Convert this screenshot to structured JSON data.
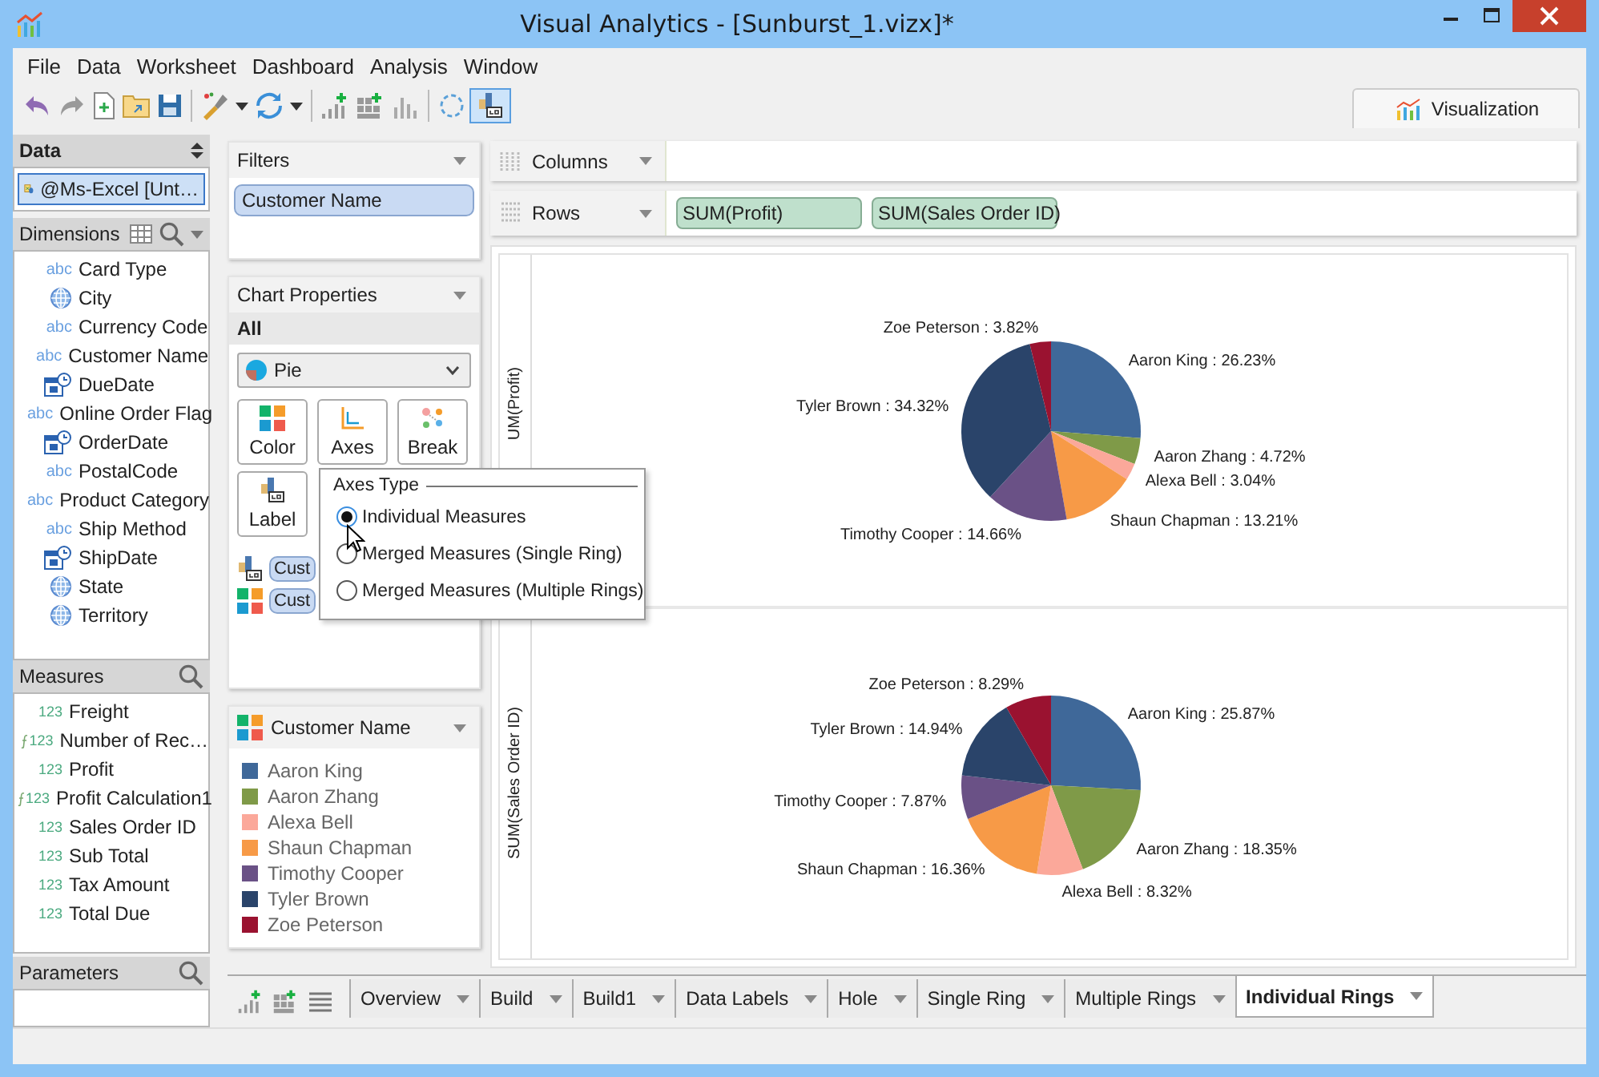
{
  "window": {
    "title": "Visual Analytics - [Sunburst_1.vizx]*"
  },
  "menu": [
    "File",
    "Data",
    "Worksheet",
    "Dashboard",
    "Analysis",
    "Window"
  ],
  "toolbar": {
    "label_toggle": {
      "selected": true
    }
  },
  "visualization_tab": {
    "label": "Visualization"
  },
  "data_panel": {
    "title": "Data",
    "source": {
      "label": "@Ms-Excel [Unt…",
      "selected": true
    },
    "dimensions": {
      "title": "Dimensions",
      "items": [
        {
          "name": "Card Type",
          "kind": "text",
          "type_badge": "abc"
        },
        {
          "name": "City",
          "kind": "geo"
        },
        {
          "name": "Currency Code",
          "kind": "text",
          "type_badge": "abc"
        },
        {
          "name": "Customer Name",
          "kind": "text",
          "type_badge": "abc"
        },
        {
          "name": "DueDate",
          "kind": "date"
        },
        {
          "name": "Online Order Flag",
          "kind": "text",
          "type_badge": "abc"
        },
        {
          "name": "OrderDate",
          "kind": "date"
        },
        {
          "name": "PostalCode",
          "kind": "text",
          "type_badge": "abc"
        },
        {
          "name": "Product Category",
          "kind": "text",
          "type_badge": "abc"
        },
        {
          "name": "Ship Method",
          "kind": "text",
          "type_badge": "abc"
        },
        {
          "name": "ShipDate",
          "kind": "date"
        },
        {
          "name": "State",
          "kind": "geo"
        },
        {
          "name": "Territory",
          "kind": "geo"
        }
      ]
    },
    "measures": {
      "title": "Measures",
      "items": [
        {
          "name": "Freight",
          "type_badge": "123",
          "calculated": false
        },
        {
          "name": "Number of Rec…",
          "type_badge": "123",
          "calculated": true
        },
        {
          "name": "Profit",
          "type_badge": "123",
          "calculated": false
        },
        {
          "name": "Profit Calculation1",
          "type_badge": "123",
          "calculated": true
        },
        {
          "name": "Sales Order ID",
          "type_badge": "123",
          "calculated": false
        },
        {
          "name": "Sub Total",
          "type_badge": "123",
          "calculated": false
        },
        {
          "name": "Tax Amount",
          "type_badge": "123",
          "calculated": false
        },
        {
          "name": "Total Due",
          "type_badge": "123",
          "calculated": false
        }
      ]
    },
    "parameters": {
      "title": "Parameters"
    }
  },
  "filters": {
    "title": "Filters",
    "pills": [
      "Customer Name"
    ]
  },
  "chart_properties": {
    "title": "Chart Properties",
    "scope": "All",
    "chart_type": "Pie",
    "buttons": [
      {
        "label": "Color",
        "kind": "color"
      },
      {
        "label": "Axes",
        "kind": "axes"
      },
      {
        "label": "Break",
        "kind": "break"
      },
      {
        "label": "Label",
        "kind": "label"
      }
    ],
    "marks": [
      {
        "kind": "label",
        "pill": "Cust"
      },
      {
        "kind": "color",
        "pill": "Cust"
      }
    ]
  },
  "axes_popup": {
    "title": "Axes Type",
    "options": [
      {
        "label": "Individual Measures",
        "selected": true
      },
      {
        "label": "Merged Measures (Single Ring)",
        "selected": false
      },
      {
        "label": "Merged Measures (Multiple Rings)",
        "selected": false
      }
    ]
  },
  "legend": {
    "title": "Customer Name",
    "items": [
      {
        "name": "Aaron King",
        "color": "#3f6899"
      },
      {
        "name": "Aaron Zhang",
        "color": "#7f9a48"
      },
      {
        "name": "Alexa Bell",
        "color": "#fba89a"
      },
      {
        "name": "Shaun Chapman",
        "color": "#f79a47"
      },
      {
        "name": "Timothy Cooper",
        "color": "#6a5186"
      },
      {
        "name": "Tyler Brown",
        "color": "#2a446a"
      },
      {
        "name": "Zoe Peterson",
        "color": "#9a1230"
      }
    ]
  },
  "shelves": {
    "columns": {
      "label": "Columns"
    },
    "rows": {
      "label": "Rows",
      "pills": [
        "SUM(Profit)",
        "SUM(Sales Order ID)"
      ]
    }
  },
  "charts": [
    {
      "axis_label": "UM(Profit)",
      "chart_data": {
        "type": "pie",
        "values": [
          26.23,
          4.72,
          3.04,
          13.21,
          14.66,
          34.32,
          3.82
        ],
        "value_labels": [
          "Aaron King : 26.23%",
          "Aaron Zhang : 4.72%",
          "Alexa Bell : 3.04%",
          "Shaun Chapman : 13.21%",
          "Timothy Cooper : 14.66%",
          "Tyler Brown : 34.32%",
          "Zoe Peterson : 3.82%"
        ]
      }
    },
    {
      "axis_label": "SUM(Sales Order ID)",
      "chart_data": {
        "type": "pie",
        "values": [
          25.87,
          18.35,
          8.32,
          16.36,
          7.87,
          14.94,
          8.29
        ],
        "value_labels": [
          "Aaron King : 25.87%",
          "Aaron Zhang : 18.35%",
          "Alexa Bell : 8.32%",
          "Shaun Chapman : 16.36%",
          "Timothy Cooper : 7.87%",
          "Tyler Brown : 14.94%",
          "Zoe Peterson : 8.29%"
        ]
      }
    }
  ],
  "sheet_tabs": [
    {
      "label": "Overview",
      "selected": false
    },
    {
      "label": "Build",
      "selected": false
    },
    {
      "label": "Build1",
      "selected": false
    },
    {
      "label": "Data Labels",
      "selected": false
    },
    {
      "label": "Hole",
      "selected": false
    },
    {
      "label": "Single Ring",
      "selected": false
    },
    {
      "label": "Multiple Rings",
      "selected": false
    },
    {
      "label": "Individual Rings",
      "selected": true
    }
  ]
}
